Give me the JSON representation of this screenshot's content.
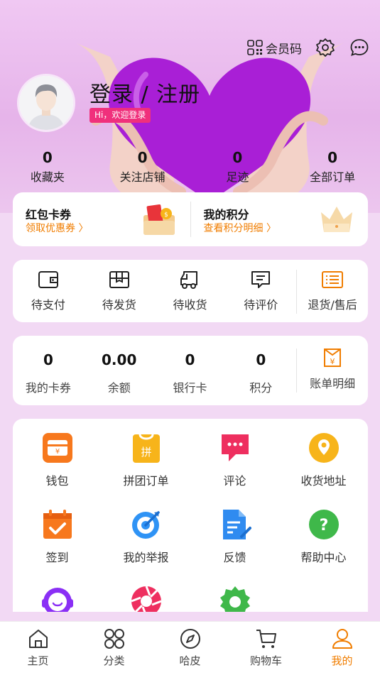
{
  "header": {
    "member_code_label": "会员码",
    "login_title": "登录 / 注册",
    "welcome": "Hi，欢迎登录",
    "stats": [
      {
        "num": "0",
        "label": "收藏夹"
      },
      {
        "num": "0",
        "label": "关注店铺"
      },
      {
        "num": "0",
        "label": "足迹"
      },
      {
        "num": "0",
        "label": "全部订单"
      }
    ]
  },
  "promo": {
    "left": {
      "title": "红包卡券",
      "subtitle": "领取优惠券 〉"
    },
    "right": {
      "title": "我的积分",
      "subtitle": "查看积分明细 〉"
    }
  },
  "orders": [
    {
      "label": "待支付",
      "icon": "wallet-icon"
    },
    {
      "label": "待发货",
      "icon": "box-icon"
    },
    {
      "label": "待收货",
      "icon": "truck-icon"
    },
    {
      "label": "待评价",
      "icon": "comment-icon"
    },
    {
      "label": "退货/售后",
      "icon": "list-icon"
    }
  ],
  "assets": [
    {
      "num": "0",
      "label": "我的卡券"
    },
    {
      "num": "0.00",
      "label": "余额"
    },
    {
      "num": "0",
      "label": "银行卡"
    },
    {
      "num": "0",
      "label": "积分"
    }
  ],
  "bill_label": "账单明细",
  "tools": [
    {
      "label": "钱包",
      "icon": "wallet-icon",
      "color": "#f7781d"
    },
    {
      "label": "拼团订单",
      "icon": "group-order-icon",
      "color": "#f7b41a"
    },
    {
      "label": "评论",
      "icon": "chat-icon",
      "color": "#ee2f5f"
    },
    {
      "label": "收货地址",
      "icon": "location-icon",
      "color": "#f7b41a"
    },
    {
      "label": "签到",
      "icon": "calendar-check-icon",
      "color": "#f7781d"
    },
    {
      "label": "我的举报",
      "icon": "target-icon",
      "color": "#2f93f5"
    },
    {
      "label": "反馈",
      "icon": "document-edit-icon",
      "color": "#2f8bf0"
    },
    {
      "label": "帮助中心",
      "icon": "help-icon",
      "color": "#3fb84a"
    },
    {
      "label": "",
      "icon": "customer-service-icon",
      "color": "#8a2ff5"
    },
    {
      "label": "",
      "icon": "aperture-icon",
      "color": "#ee2f5f"
    },
    {
      "label": "",
      "icon": "settings-icon",
      "color": "#3fb84a"
    }
  ],
  "nav": [
    {
      "label": "主页",
      "icon": "home-icon"
    },
    {
      "label": "分类",
      "icon": "category-icon"
    },
    {
      "label": "哈皮",
      "icon": "compass-icon"
    },
    {
      "label": "购物车",
      "icon": "cart-icon"
    },
    {
      "label": "我的",
      "icon": "user-icon",
      "active": true
    }
  ],
  "colors": {
    "accent": "#f07d00",
    "badge": "#f0307c"
  }
}
